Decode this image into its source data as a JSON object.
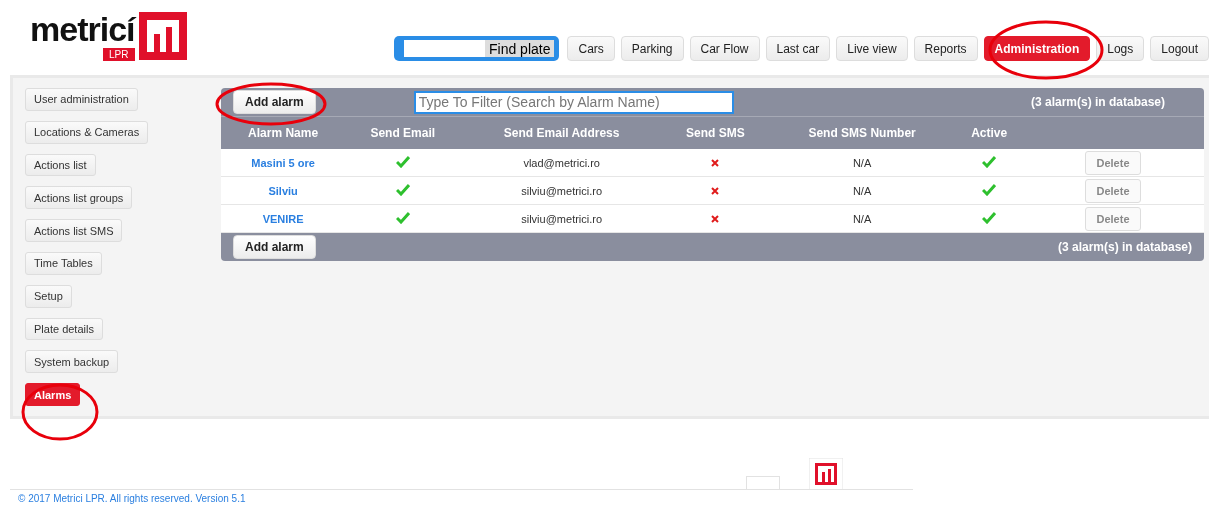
{
  "header": {
    "logo": {
      "word": "metricí",
      "badge": "LPR"
    },
    "search": {
      "button": "Find plate"
    },
    "nav": [
      {
        "label": "Cars",
        "selected": false
      },
      {
        "label": "Parking",
        "selected": false
      },
      {
        "label": "Car Flow",
        "selected": false
      },
      {
        "label": "Last car",
        "selected": false
      },
      {
        "label": "Live view",
        "selected": false
      },
      {
        "label": "Reports",
        "selected": false
      },
      {
        "label": "Administration",
        "selected": true
      },
      {
        "label": "Logs",
        "selected": false
      },
      {
        "label": "Logout",
        "selected": false
      }
    ]
  },
  "sidebar": {
    "items": [
      {
        "label": "User administration",
        "selected": false
      },
      {
        "label": "Locations & Cameras",
        "selected": false
      },
      {
        "label": "Actions list",
        "selected": false
      },
      {
        "label": "Actions list groups",
        "selected": false
      },
      {
        "label": "Actions list SMS",
        "selected": false
      },
      {
        "label": "Time Tables",
        "selected": false
      },
      {
        "label": "Setup",
        "selected": false
      },
      {
        "label": "Plate details",
        "selected": false
      },
      {
        "label": "System backup",
        "selected": false
      },
      {
        "label": "Alarms",
        "selected": true
      }
    ]
  },
  "table": {
    "add_button": "Add alarm",
    "filter": {
      "placeholder": "Type To Filter (Search by Alarm Name)"
    },
    "count": "(3 alarm(s) in database)",
    "columns": [
      "Alarm Name",
      "Send Email",
      "Send Email Address",
      "Send SMS",
      "Send SMS Number",
      "Active"
    ],
    "rows": [
      {
        "name": "Masini 5 ore",
        "send_email": true,
        "email": "vlad@metrici.ro",
        "send_sms": false,
        "sms_number": "N/A",
        "active": true,
        "action": "Delete"
      },
      {
        "name": "Silviu",
        "send_email": true,
        "email": "silviu@metrici.ro",
        "send_sms": false,
        "sms_number": "N/A",
        "active": true,
        "action": "Delete"
      },
      {
        "name": "VENIRE",
        "send_email": true,
        "email": "silviu@metrici.ro",
        "send_sms": false,
        "sms_number": "N/A",
        "active": true,
        "action": "Delete"
      }
    ],
    "footer_button": "Add alarm",
    "footer_count": "(3 alarm(s) in database)"
  },
  "footer": {
    "copyright": "© 2017 Metrici LPR. All rights reserved. Version 5.1"
  }
}
